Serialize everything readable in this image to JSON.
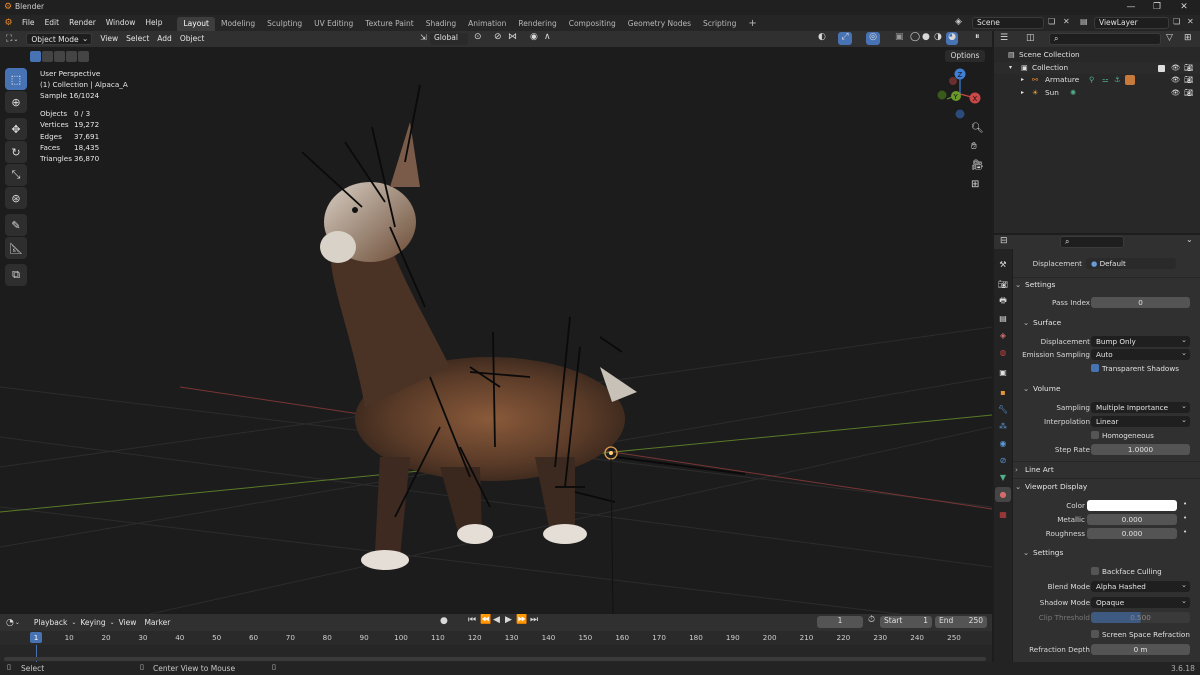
{
  "app": {
    "title": "Blender",
    "version": "3.6.18"
  },
  "menu": [
    "File",
    "Edit",
    "Render",
    "Window",
    "Help"
  ],
  "workspaces": [
    {
      "label": "Layout",
      "active": true
    },
    {
      "label": "Modeling"
    },
    {
      "label": "Sculpting"
    },
    {
      "label": "UV Editing"
    },
    {
      "label": "Texture Paint"
    },
    {
      "label": "Shading"
    },
    {
      "label": "Animation"
    },
    {
      "label": "Rendering"
    },
    {
      "label": "Compositing"
    },
    {
      "label": "Geometry Nodes"
    },
    {
      "label": "Scripting"
    }
  ],
  "scene": {
    "name": "Scene",
    "view_layer": "ViewLayer"
  },
  "viewport_header": {
    "mode": "Object Mode",
    "menus": [
      "View",
      "Select",
      "Add",
      "Object"
    ],
    "orientation": "Global",
    "options_label": "Options"
  },
  "viewport": {
    "perspective": "User Perspective",
    "collection_line": "(1) Collection | Alpaca_A",
    "sample": "Sample 16/1024",
    "stats": [
      {
        "label": "Objects",
        "value": "0 / 3"
      },
      {
        "label": "Vertices",
        "value": "19,272"
      },
      {
        "label": "Edges",
        "value": "37,691"
      },
      {
        "label": "Faces",
        "value": "18,435"
      },
      {
        "label": "Triangles",
        "value": "36,870"
      }
    ],
    "gizmo": {
      "x": "X",
      "y": "Y",
      "z": "Z"
    }
  },
  "outliner": {
    "rows": [
      {
        "label": "Scene Collection",
        "depth": 0
      },
      {
        "label": "Collection",
        "depth": 1
      },
      {
        "label": "Armature",
        "depth": 2
      },
      {
        "label": "Sun",
        "depth": 2
      }
    ]
  },
  "properties": {
    "displacement_method": {
      "label": "Displacement",
      "value": "Default"
    },
    "settings_title": "Settings",
    "pass_index": {
      "label": "Pass Index",
      "value": "0"
    },
    "surface_title": "Surface",
    "surface_displacement": {
      "label": "Displacement",
      "value": "Bump Only"
    },
    "emission_sampling": {
      "label": "Emission Sampling",
      "value": "Auto"
    },
    "transparent_shadows": {
      "label": "Transparent Shadows",
      "checked": true
    },
    "volume_title": "Volume",
    "sampling": {
      "label": "Sampling",
      "value": "Multiple Importance"
    },
    "interpolation": {
      "label": "Interpolation",
      "value": "Linear"
    },
    "homogeneous": {
      "label": "Homogeneous",
      "checked": false
    },
    "step_rate": {
      "label": "Step Rate",
      "value": "1.0000"
    },
    "line_art_title": "Line Art",
    "viewport_display_title": "Viewport Display",
    "color": {
      "label": "Color",
      "value": "#ffffff"
    },
    "metallic": {
      "label": "Metallic",
      "value": "0.000"
    },
    "roughness": {
      "label": "Roughness",
      "value": "0.000"
    },
    "vd_settings_title": "Settings",
    "backface_culling": {
      "label": "Backface Culling",
      "checked": false
    },
    "blend_mode": {
      "label": "Blend Mode",
      "value": "Alpha Hashed"
    },
    "shadow_mode": {
      "label": "Shadow Mode",
      "value": "Opaque"
    },
    "clip_threshold": {
      "label": "Clip Threshold",
      "value": "0.500"
    },
    "ssr": {
      "label": "Screen Space Refraction",
      "checked": false
    },
    "refraction_depth": {
      "label": "Refraction Depth",
      "value": "0 m"
    }
  },
  "timeline": {
    "menus": [
      "Playback",
      "Keying",
      "View",
      "Marker"
    ],
    "current_frame": "1",
    "start_label": "Start",
    "start": "1",
    "end_label": "End",
    "end": "250",
    "ticks": [
      "1",
      "10",
      "20",
      "30",
      "40",
      "50",
      "60",
      "70",
      "80",
      "90",
      "100",
      "110",
      "120",
      "130",
      "140",
      "150",
      "160",
      "170",
      "180",
      "190",
      "200",
      "210",
      "220",
      "230",
      "240",
      "250"
    ]
  },
  "statusbar": {
    "select": "Select",
    "center_view": "Center View to Mouse"
  },
  "colors": {
    "accent": "#4772b3",
    "x_axis": "#c94848",
    "y_axis": "#6a9a2a",
    "z_axis": "#3f7fd6"
  }
}
